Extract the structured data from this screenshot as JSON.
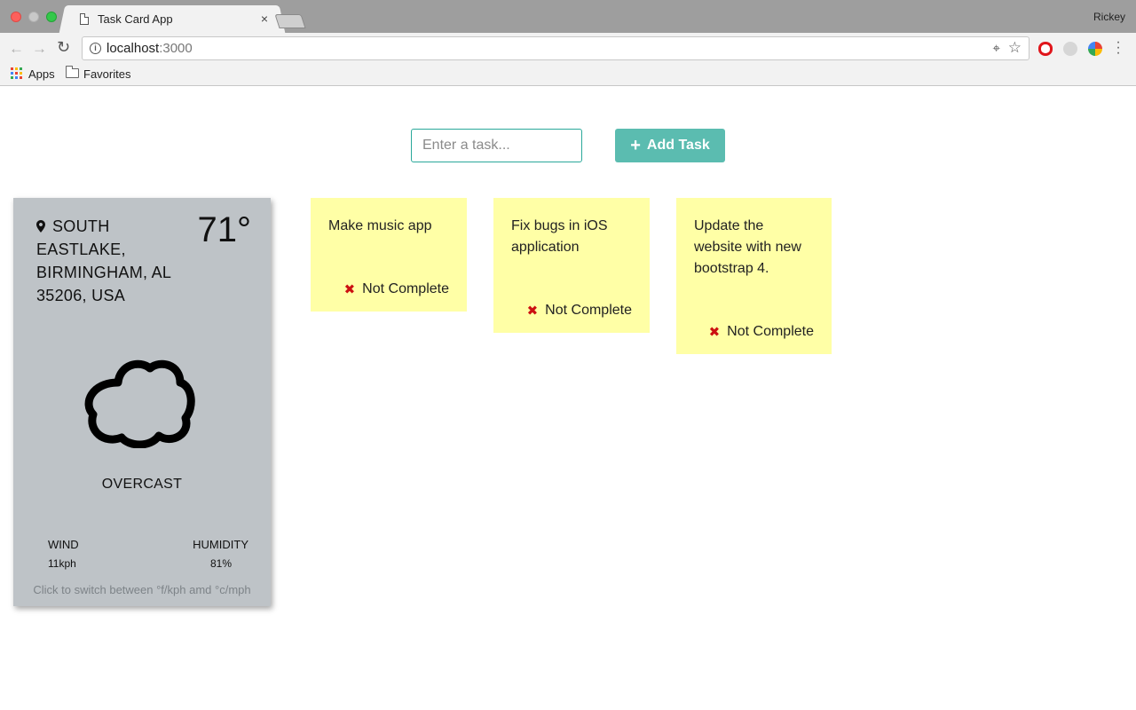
{
  "browser": {
    "tab_title": "Task Card App",
    "tab_close": "×",
    "profile_name": "Rickey",
    "url_host": "localhost",
    "url_port": ":3000",
    "bookmarks": [
      {
        "label": "Apps",
        "icon": "apps-grid-icon"
      },
      {
        "label": "Favorites",
        "icon": "folder-icon"
      }
    ]
  },
  "task_form": {
    "placeholder": "Enter a task...",
    "value": "",
    "add_label": "Add Task",
    "add_icon": "plus-icon"
  },
  "weather": {
    "location": "SOUTH EASTLAKE, BIRMINGHAM, AL 35206, USA",
    "temperature": "71°",
    "condition": "OVERCAST",
    "condition_icon": "cloud-icon",
    "wind_label": "WIND",
    "wind_value": "11kph",
    "humidity_label": "HUMIDITY",
    "humidity_value": "81%",
    "switch_hint": "Click to switch between °f/kph amd °c/mph",
    "card_color": "#bec3c7"
  },
  "tasks": [
    {
      "text": "Make music app",
      "status": "Not Complete"
    },
    {
      "text": "Fix bugs in iOS application",
      "status": "Not Complete"
    },
    {
      "text": "Update the website with new bootstrap 4.",
      "status": "Not Complete"
    }
  ],
  "colors": {
    "accent": "#5bbcb0",
    "card_bg": "#ffffa6",
    "incomplete": "#cc1111"
  }
}
